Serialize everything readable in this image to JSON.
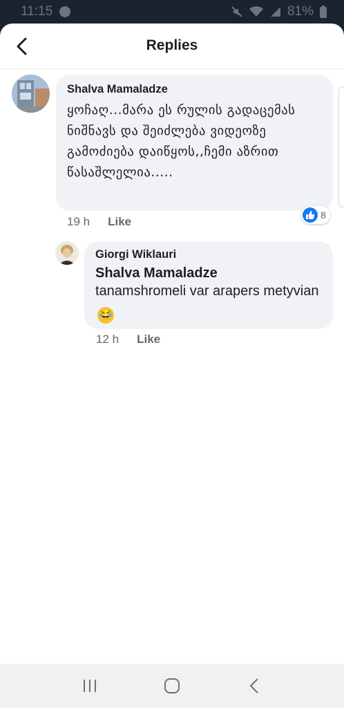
{
  "status_bar": {
    "time": "11:15",
    "battery": "81%"
  },
  "header": {
    "title": "Replies"
  },
  "comments": [
    {
      "author": "Shalva Mamaladze",
      "text": "ყოჩაღ...მარა ეს რულის გადაცემას ნიშნავს და შეიძლება ვიდეოზე გამოძიება დაიწყოს,,ჩემი აზრით წასაშლელია.....",
      "time": "19 h",
      "like_label": "Like",
      "reaction_count": "8"
    }
  ],
  "replies": [
    {
      "author": "Giorgi Wiklauri",
      "mention": "Shalva Mamaladze",
      "text": "tanamshromeli var arapers metyvian",
      "emoji": "😂",
      "time": "12 h",
      "like_label": "Like"
    }
  ],
  "icons": {
    "back": "chevron-left-icon",
    "reaction": "thumbs-up-icon",
    "nav_recents": "recents-icon",
    "nav_home": "home-icon",
    "nav_back": "back-icon"
  },
  "colors": {
    "accent": "#1877f2",
    "bubble": "#f0f2f5",
    "meta": "#65676b"
  }
}
